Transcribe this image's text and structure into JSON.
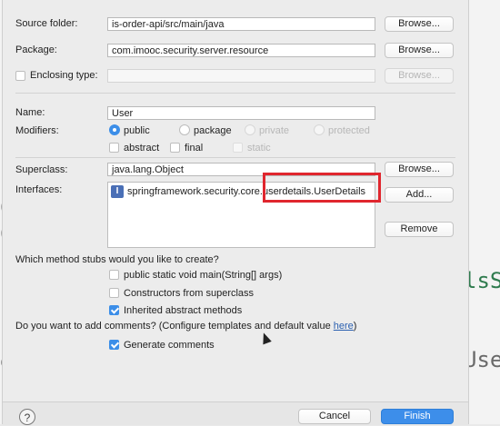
{
  "background": {
    "code_fragments": [
      {
        "text": "C"
      },
      {
        "text": "C"
      },
      {
        "text": "r"
      },
      {
        "text": "e"
      },
      {
        "text": "lsS"
      },
      {
        "text": "Use"
      }
    ]
  },
  "dialog": {
    "source_folder": {
      "label": "Source folder:",
      "value": "is-order-api/src/main/java",
      "browse": "Browse..."
    },
    "package": {
      "label": "Package:",
      "value": "com.imooc.security.server.resource",
      "browse": "Browse..."
    },
    "enclosing_type": {
      "label": "Enclosing type:",
      "value": "",
      "browse": "Browse..."
    },
    "name": {
      "label": "Name:",
      "value": "User"
    },
    "modifiers": {
      "label": "Modifiers:",
      "options": {
        "public": "public",
        "package": "package",
        "private": "private",
        "protected": "protected"
      },
      "checks": {
        "abstract": "abstract",
        "final": "final",
        "static": "static"
      }
    },
    "superclass": {
      "label": "Superclass:",
      "value": "java.lang.Object",
      "browse": "Browse..."
    },
    "interfaces": {
      "label": "Interfaces:",
      "item_icon": "I",
      "item_text": "springframework.security.core.userdetails.UserDetails",
      "add": "Add...",
      "remove": "Remove"
    },
    "stubs": {
      "question": "Which method stubs would you like to create?",
      "options": {
        "main": "public static void main(String[] args)",
        "constructors": "Constructors from superclass",
        "inherited": "Inherited abstract methods"
      }
    },
    "comments": {
      "question_prefix": "Do you want to add comments? (Configure templates and default value ",
      "link": "here",
      "question_suffix": ")",
      "generate": "Generate comments"
    },
    "footer": {
      "help": "?",
      "cancel": "Cancel",
      "finish": "Finish"
    }
  },
  "colors": {
    "accent": "#3c8ee8",
    "highlight": "#e0262e"
  }
}
